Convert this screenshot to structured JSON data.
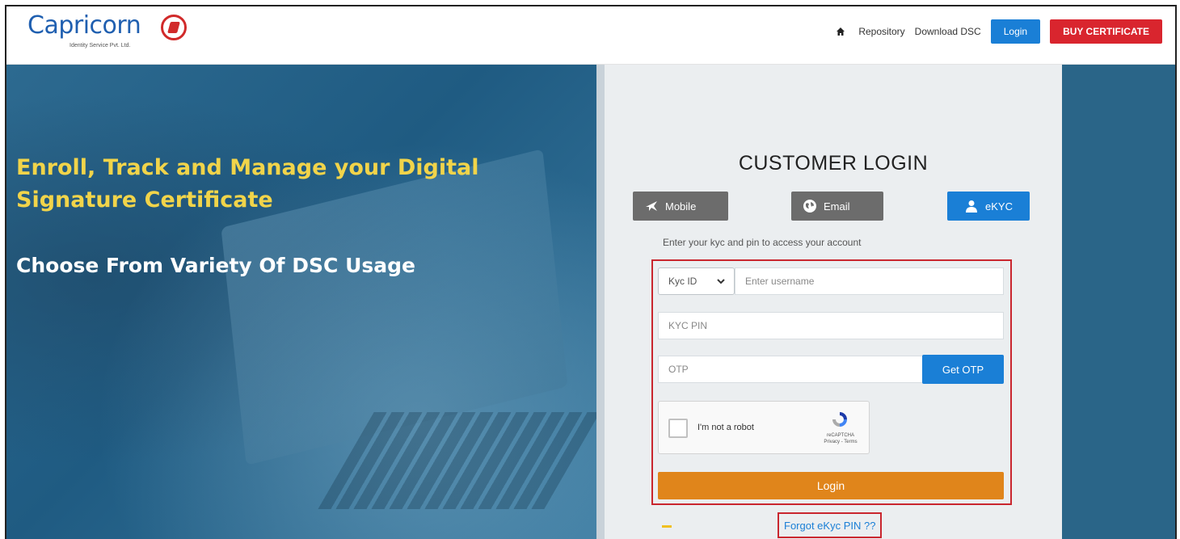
{
  "brand": {
    "name": "Capricorn",
    "subtitle": "Identity Service Pvt. Ltd.",
    "accent": "#1f5fb0",
    "mark_color": "#d12a2a"
  },
  "nav": {
    "home_icon": "home-icon",
    "repository": "Repository",
    "download_dsc": "Download DSC",
    "login": "Login",
    "buy_certificate": "BUY CERTIFICATE"
  },
  "hero": {
    "headline": "Enroll, Track and Manage your Digital Signature Certificate",
    "subheadline": "Choose From Variety Of DSC Usage",
    "headline_color": "#f1d44a"
  },
  "login": {
    "title": "CUSTOMER LOGIN",
    "tabs": [
      {
        "label": "Mobile",
        "icon": "plane-icon",
        "active": false
      },
      {
        "label": "Email",
        "icon": "globe-icon",
        "active": false
      },
      {
        "label": "eKYC",
        "icon": "user-icon",
        "active": true
      }
    ],
    "hint": "Enter your kyc and pin to access your account",
    "id_type": {
      "selected": "Kyc ID"
    },
    "username": {
      "placeholder": "Enter username",
      "value": ""
    },
    "pin": {
      "placeholder": "KYC PIN",
      "value": ""
    },
    "otp": {
      "placeholder": "OTP",
      "value": ""
    },
    "get_otp": "Get OTP",
    "captcha": {
      "label": "I'm not a robot",
      "brand": "reCAPTCHA",
      "links": "Privacy - Terms"
    },
    "submit": "Login",
    "forgot": "Forgot eKyc PIN ??"
  },
  "colors": {
    "primary": "#1a7fd6",
    "danger": "#d9252e",
    "submit": "#e0851b",
    "highlight_border": "#c9262e"
  }
}
